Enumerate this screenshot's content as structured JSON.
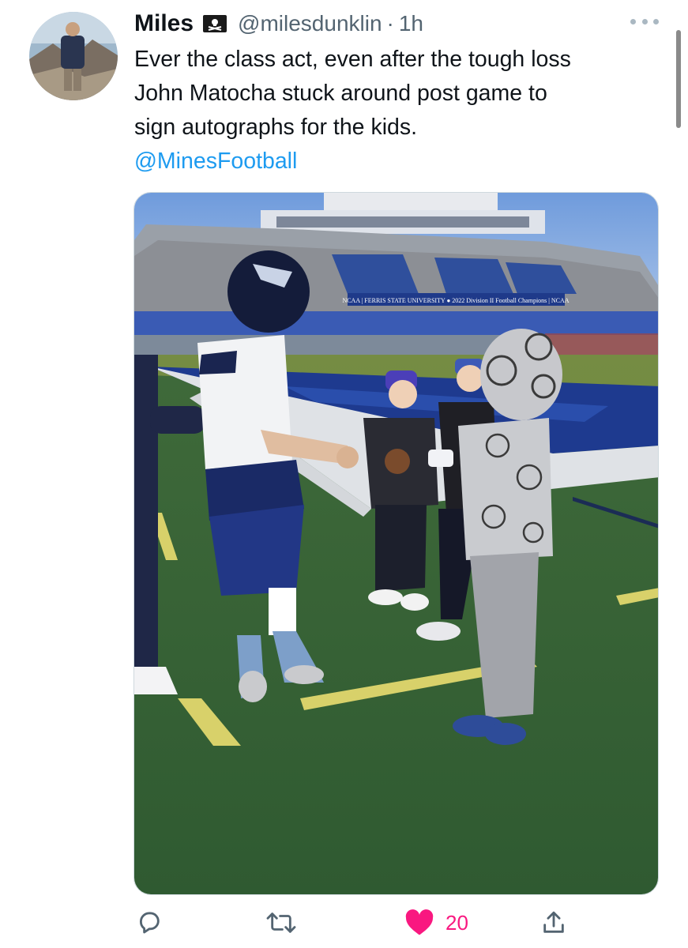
{
  "tweet": {
    "author": {
      "display_name": "Miles",
      "handle": "@milesdunklin",
      "separator": "·",
      "time": "1h",
      "avatar_icon": "user-avatar-photo",
      "badge_icon": "pirate-flag-icon"
    },
    "text_lines": [
      "Ever the class act, even after the tough loss",
      "John Matocha stuck around post game to",
      "sign autographs for the kids."
    ],
    "mention": "@MinesFootball",
    "media": {
      "banner_text": "NCAA  |  FERRIS STATE UNIVERSITY  ●  2022 Division II Football Champions  |  NCAA"
    },
    "actions": {
      "reply_icon": "reply-icon",
      "retweet_icon": "retweet-icon",
      "like_icon": "heart-icon",
      "like_count": "20",
      "share_icon": "share-icon"
    }
  },
  "colors": {
    "link": "#1d9bf0",
    "like": "#f91880",
    "muted": "#536471"
  }
}
